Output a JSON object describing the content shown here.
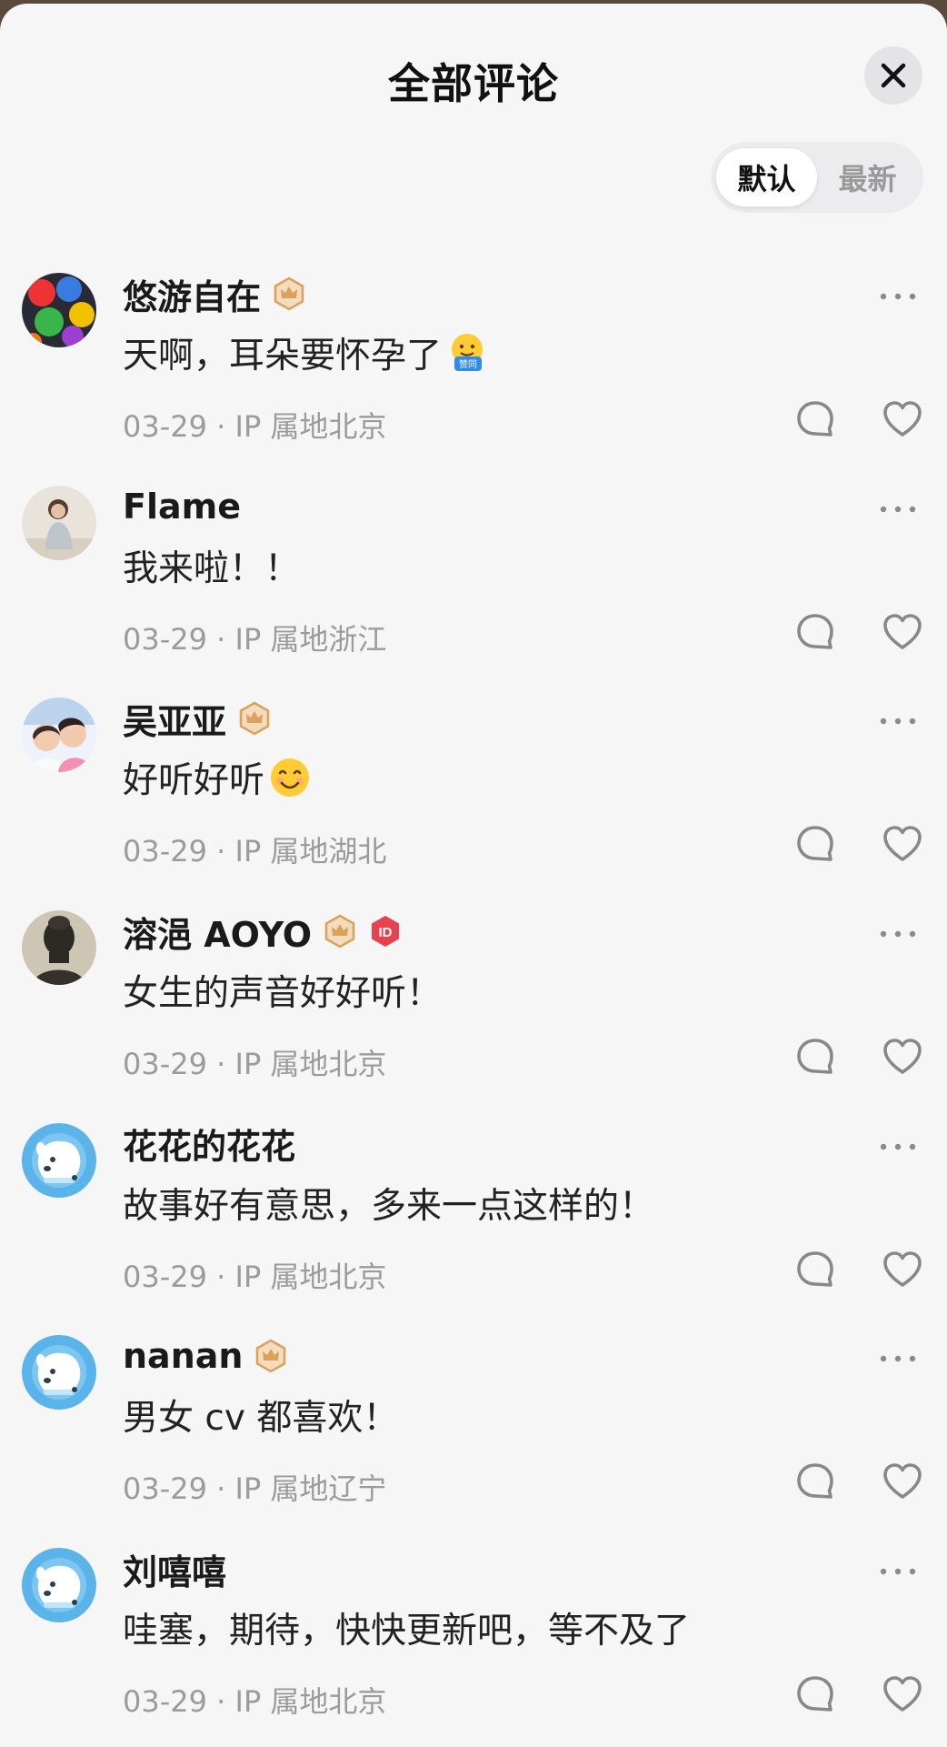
{
  "header": {
    "title": "全部评论"
  },
  "sort": {
    "default_label": "默认",
    "latest_label": "最新"
  },
  "comments": [
    {
      "name": "悠游自在",
      "text": "天啊，耳朵要怀孕了",
      "emoji": "thumbs-agree-emoji",
      "emoji_label": "赞同",
      "date": "03-29",
      "ip": "IP 属地北京",
      "badges": [
        "crown-badge"
      ],
      "avatar": "colorful-clocks-avatar"
    },
    {
      "name": "Flame",
      "text": "我来啦！！",
      "date": "03-29",
      "ip": "IP 属地浙江",
      "badges": [],
      "avatar": "woman-photo-avatar"
    },
    {
      "name": "吴亚亚",
      "text": "好听好听",
      "emoji": "smile-emoji",
      "date": "03-29",
      "ip": "IP 属地湖北",
      "badges": [
        "crown-badge"
      ],
      "avatar": "kids-photo-avatar"
    },
    {
      "name": "溶浥 AOYO",
      "text": "女生的声音好好听！",
      "date": "03-29",
      "ip": "IP 属地北京",
      "badges": [
        "crown-badge",
        "ip-badge"
      ],
      "avatar": "buddha-statue-avatar"
    },
    {
      "name": "花花的花花",
      "text": "故事好有意思，多来一点这样的！",
      "date": "03-29",
      "ip": "IP 属地北京",
      "badges": [],
      "avatar": "default-dog-avatar"
    },
    {
      "name": "nanan",
      "text": "男女 cv 都喜欢！",
      "date": "03-29",
      "ip": "IP 属地辽宁",
      "badges": [
        "crown-badge"
      ],
      "avatar": "default-dog-avatar"
    },
    {
      "name": "刘嘻嘻",
      "text": "哇塞，期待，快快更新吧，等不及了",
      "date": "03-29",
      "ip": "IP 属地北京",
      "badges": [],
      "avatar": "default-dog-avatar"
    }
  ],
  "meta_separator": " · ",
  "colors": {
    "accent_badge": "#d9a15a",
    "ip_badge": "#e8424f",
    "default_avatar_bg": "#5ab4ea"
  }
}
